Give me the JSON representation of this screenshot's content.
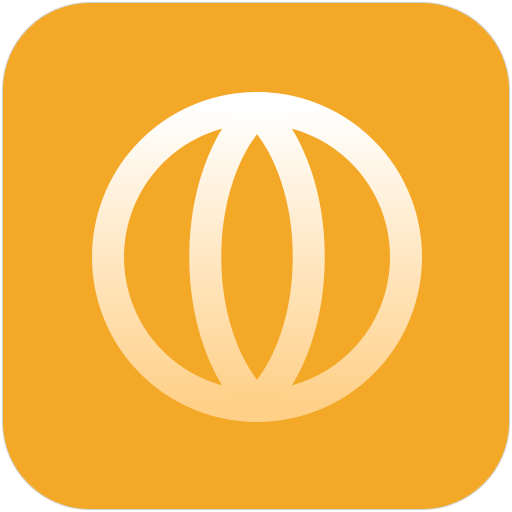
{
  "app_icon": {
    "icon": "globe-icon",
    "background_color": "#F4A827",
    "border_color": "#CFCFCF",
    "glyph_color_top": "#FFFFFF",
    "glyph_color_bottom": "#FFD088"
  }
}
